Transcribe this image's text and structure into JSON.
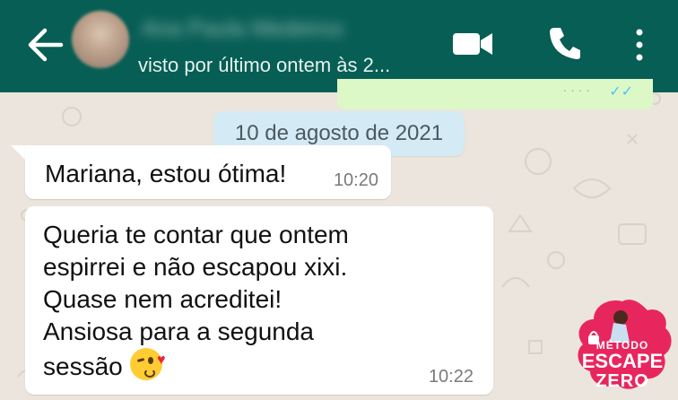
{
  "header": {
    "contact_name": "Ana Paula Medeiros",
    "last_seen": "visto por último ontem às 2..."
  },
  "messages": {
    "date_chip": "10 de agosto de 2021",
    "msg1": {
      "text": "Mariana, estou ótima!",
      "time": "10:20"
    },
    "msg2": {
      "lines": [
        "Queria te contar que ontem",
        "espirrei e não escapou xixi.",
        "Quase nem acreditei!",
        "Ansiosa para a segunda",
        "sessão"
      ],
      "emoji": "face-blowing-a-kiss",
      "time": "10:22"
    }
  },
  "logo": {
    "line1": "MÉTODO",
    "line2": "ESCAPE",
    "line3": "ZERO"
  },
  "colors": {
    "header": "#075e54",
    "chat_background": "#ece5dd",
    "sent_bubble": "#dcf8c6",
    "date_chip": "#d4eaf4",
    "logo": "#e8265e"
  },
  "icons": [
    "back-arrow-icon",
    "video-call-icon",
    "phone-icon",
    "more-options-icon"
  ]
}
